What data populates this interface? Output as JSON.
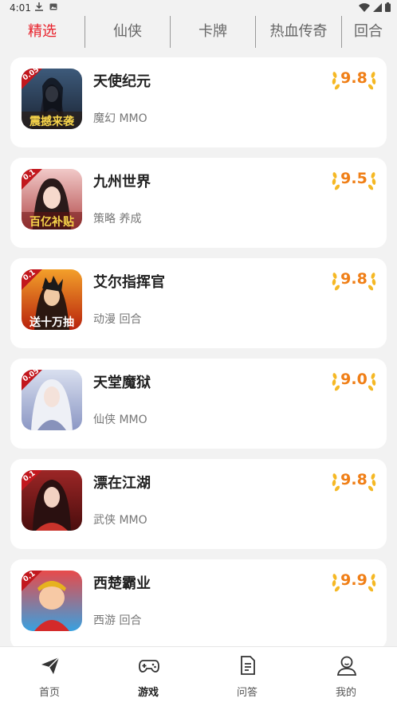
{
  "status_bar": {
    "time": "4:01"
  },
  "tabs": [
    {
      "label": "精选",
      "active": true
    },
    {
      "label": "仙侠",
      "active": false
    },
    {
      "label": "卡牌",
      "active": false
    },
    {
      "label": "热血传奇",
      "active": false
    },
    {
      "label": "回合",
      "active": false
    }
  ],
  "games": [
    {
      "name": "天使纪元",
      "tags": "魔幻 MMO",
      "rating": "9.8",
      "badge": "0.05",
      "banner": "震撼来袭"
    },
    {
      "name": "九州世界",
      "tags": "策略 养成",
      "rating": "9.5",
      "badge": "0.1",
      "banner": "百亿补贴"
    },
    {
      "name": "艾尔指挥官",
      "tags": "动漫 回合",
      "rating": "9.8",
      "badge": "0.1",
      "banner": "送十万抽"
    },
    {
      "name": "天堂魔狱",
      "tags": "仙侠 MMO",
      "rating": "9.0",
      "badge": "0.05",
      "banner": ""
    },
    {
      "name": "漂在江湖",
      "tags": "武侠 MMO",
      "rating": "9.8",
      "badge": "0.1",
      "banner": ""
    },
    {
      "name": "西楚霸业",
      "tags": "西游 回合",
      "rating": "9.9",
      "badge": "0.1",
      "banner": ""
    }
  ],
  "bottom_nav": [
    {
      "label": "首页",
      "icon": "paper-plane-icon",
      "active": false
    },
    {
      "label": "游戏",
      "icon": "gamepad-icon",
      "active": true
    },
    {
      "label": "问答",
      "icon": "document-icon",
      "active": false
    },
    {
      "label": "我的",
      "icon": "user-icon",
      "active": false
    }
  ],
  "colors": {
    "accent_red": "#e8202a",
    "rating_orange": "#f07f17",
    "laurel_gold": "#f5b824"
  }
}
